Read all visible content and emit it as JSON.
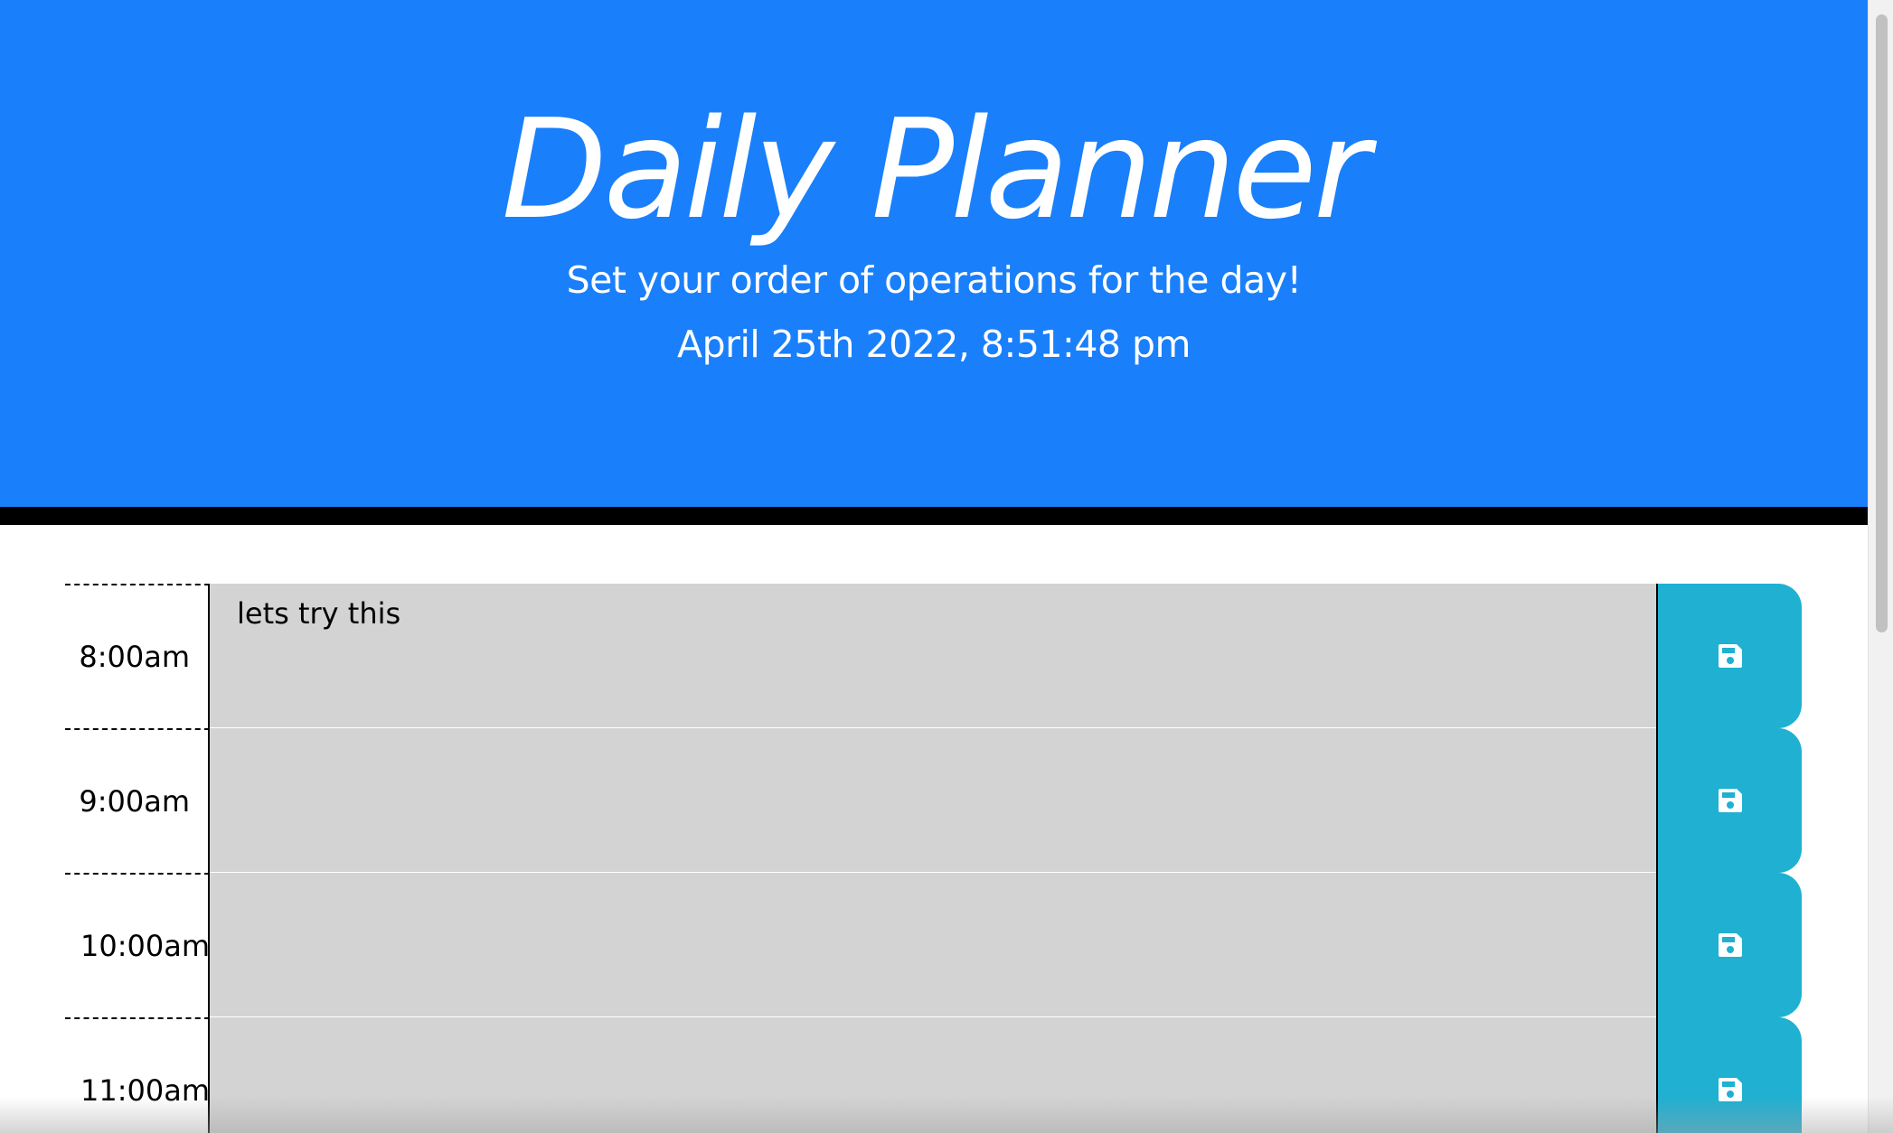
{
  "header": {
    "title": "Daily Planner",
    "lead": "Set your order of operations for the day!",
    "current_datetime": "April 25th 2022, 8:51:48 pm"
  },
  "timeblocks": [
    {
      "hour": "8:00am",
      "text": "lets try this",
      "save_icon": "floppy-disk-icon"
    },
    {
      "hour": "9:00am",
      "text": "",
      "save_icon": "floppy-disk-icon"
    },
    {
      "hour": "10:00am",
      "text": "",
      "save_icon": "floppy-disk-icon"
    },
    {
      "hour": "11:00am",
      "text": "",
      "save_icon": "floppy-disk-icon"
    }
  ],
  "colors": {
    "header_bg": "#1a7ffb",
    "past_block": "#d3d3d3",
    "save_button": "#1fb0d2"
  }
}
